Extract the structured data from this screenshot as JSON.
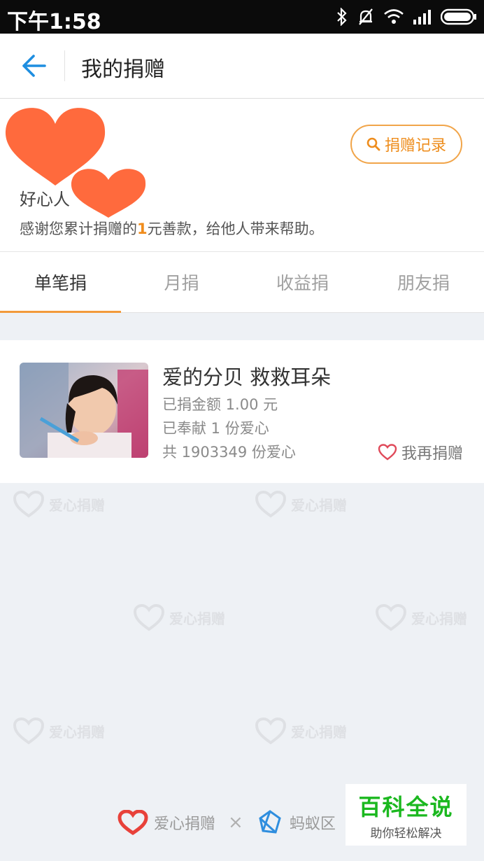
{
  "status_bar": {
    "time": "下午1:58"
  },
  "header": {
    "title": "我的捐赠"
  },
  "profile": {
    "nickname": "好心人",
    "thanks_prefix": "感谢您累计捐赠的",
    "amount": "1",
    "thanks_suffix": "元善款，给他人带来帮助。",
    "record_button": "捐赠记录"
  },
  "tabs": [
    {
      "label": "单笔捐",
      "active": true
    },
    {
      "label": "月捐",
      "active": false
    },
    {
      "label": "收益捐",
      "active": false
    },
    {
      "label": "朋友捐",
      "active": false
    }
  ],
  "donation": {
    "title": "爱的分贝 救救耳朵",
    "amount_line": "已捐金额 1.00 元",
    "contributed_line": "已奉献 1 份爱心",
    "total_line": "共 1903349 份爱心",
    "donate_again": "我再捐赠"
  },
  "watermark": {
    "text": "爱心捐赠"
  },
  "footer": {
    "brand1": "爱心捐赠",
    "separator": "×",
    "brand2": "蚂蚁区"
  },
  "badge": {
    "line1": "百科全说",
    "line2": "助你轻松解决"
  },
  "colors": {
    "accent": "#f29a3a",
    "back_arrow": "#1e8ee0",
    "heart_cover": "#ff6a3d",
    "badge_green": "#1bb81f"
  }
}
